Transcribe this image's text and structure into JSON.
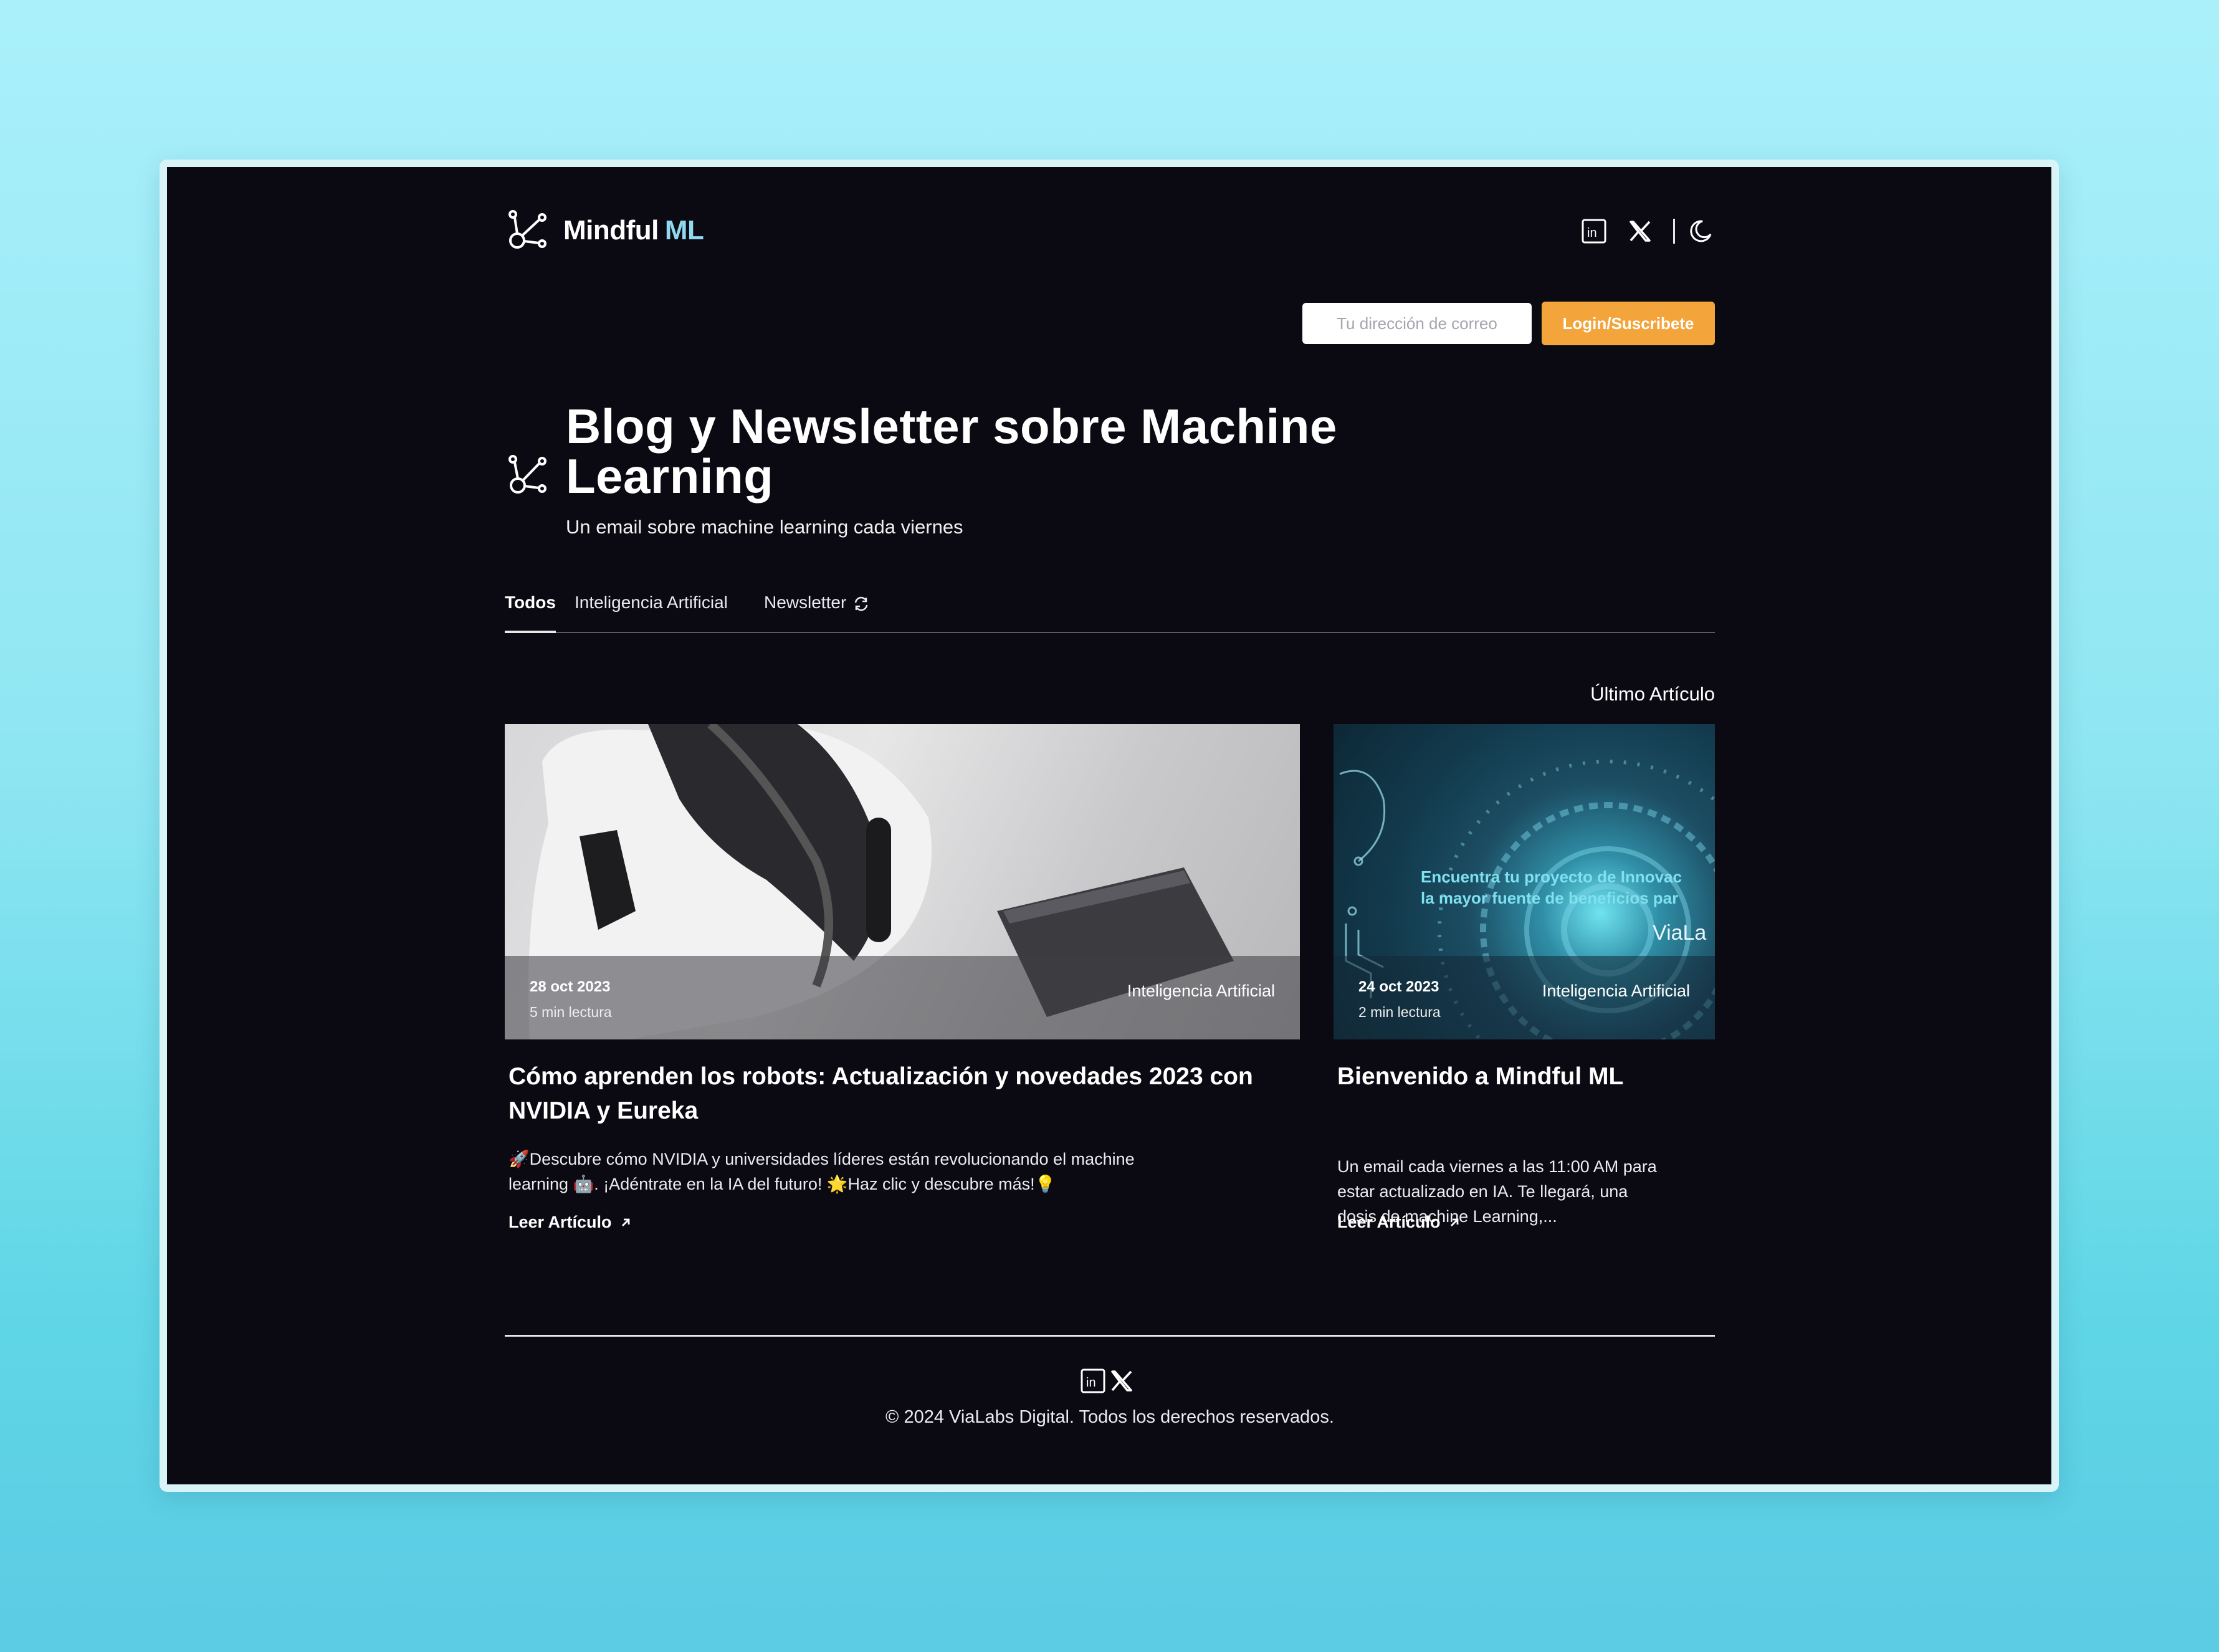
{
  "brand": {
    "name_part1": "Mindful",
    "name_part2": "ML",
    "accent_color": "#8fd8ee"
  },
  "header": {
    "email_placeholder": "Tu dirección de correo",
    "login_label": "Login/Suscribete",
    "icons": [
      "linkedin-icon",
      "x-icon",
      "moon-icon"
    ]
  },
  "hero": {
    "title": "Blog y Newsletter sobre Machine Learning",
    "subtitle": "Un email sobre machine learning cada viernes"
  },
  "tabs": [
    {
      "label": "Todos",
      "active": true
    },
    {
      "label": "Inteligencia Artificial",
      "active": false
    },
    {
      "label": "Newsletter",
      "active": false
    }
  ],
  "latest_label": "Último Artículo",
  "articles": [
    {
      "date": "28 oct 2023",
      "read_time": "5 min lectura",
      "category": "Inteligencia Artificial",
      "title": "Cómo aprenden los robots: Actualización y novedades 2023 con NVIDIA y Eureka",
      "description": "🚀Descubre cómo NVIDIA y universidades líderes están revolucionando el machine learning 🤖. ¡Adéntrate en la IA del futuro! 🌟Haz clic y descubre más!💡",
      "link": "Leer Artículo"
    },
    {
      "date": "24 oct 2023",
      "read_time": "2 min lectura",
      "category": "Inteligencia Artificial",
      "title": "Bienvenido a Mindful ML",
      "description": "Un email cada viernes a las 11:00 AM para estar actualizado en IA. Te llegará, una dosis de machine Learning,...",
      "link": "Leer Artículo",
      "image_text_line1": "Encuentra tu proyecto de Innovac",
      "image_text_line2": "la mayor fuente de beneficios par",
      "image_brand": "ViaLa"
    }
  ],
  "footer": {
    "copyright": "© 2024 ViaLabs Digital. Todos los derechos reservados."
  },
  "colors": {
    "background": "#0b0a13",
    "button": "#f3a43a"
  }
}
